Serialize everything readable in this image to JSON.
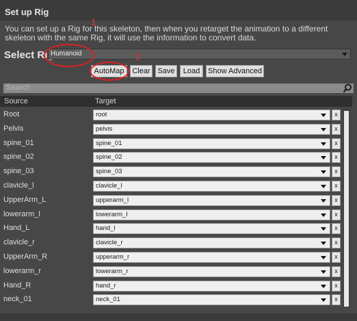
{
  "panel": {
    "title": "Set up Rig",
    "description": "You can set up a Rig for this skeleton, then when you retarget the animation to a different skeleton with the same Rig, it will use the information to convert data.",
    "select_label": "Select Rig",
    "rig_value": "Humanoid"
  },
  "toolbar": {
    "automap": "AutoMap",
    "clear": "Clear",
    "save": "Save",
    "load": "Load",
    "show_advanced": "Show Advanced"
  },
  "search": {
    "placeholder": "Search"
  },
  "columns": {
    "source": "Source",
    "target": "Target"
  },
  "rows": [
    {
      "source": "Root",
      "target": "root"
    },
    {
      "source": "Pelvis",
      "target": "pelvis"
    },
    {
      "source": "spine_01",
      "target": "spine_01"
    },
    {
      "source": "spine_02",
      "target": "spine_02"
    },
    {
      "source": "spine_03",
      "target": "spine_03"
    },
    {
      "source": "clavicle_l",
      "target": "clavicle_l"
    },
    {
      "source": "UpperArm_L",
      "target": "upperarm_l"
    },
    {
      "source": "lowerarm_l",
      "target": "lowerarm_l"
    },
    {
      "source": "Hand_L",
      "target": "hand_l"
    },
    {
      "source": "clavicle_r",
      "target": "clavicle_r"
    },
    {
      "source": "UpperArm_R",
      "target": "upperarm_r"
    },
    {
      "source": "lowerarm_r",
      "target": "lowerarm_r"
    },
    {
      "source": "Hand_R",
      "target": "hand_r"
    },
    {
      "source": "neck_01",
      "target": "neck_01"
    }
  ],
  "clear_glyph": "x",
  "annotations": {
    "one": "1",
    "two": "2"
  },
  "colors": {
    "annotation": "#e02020",
    "panel_bg": "#474747",
    "header_bg": "#3b3b3b"
  }
}
